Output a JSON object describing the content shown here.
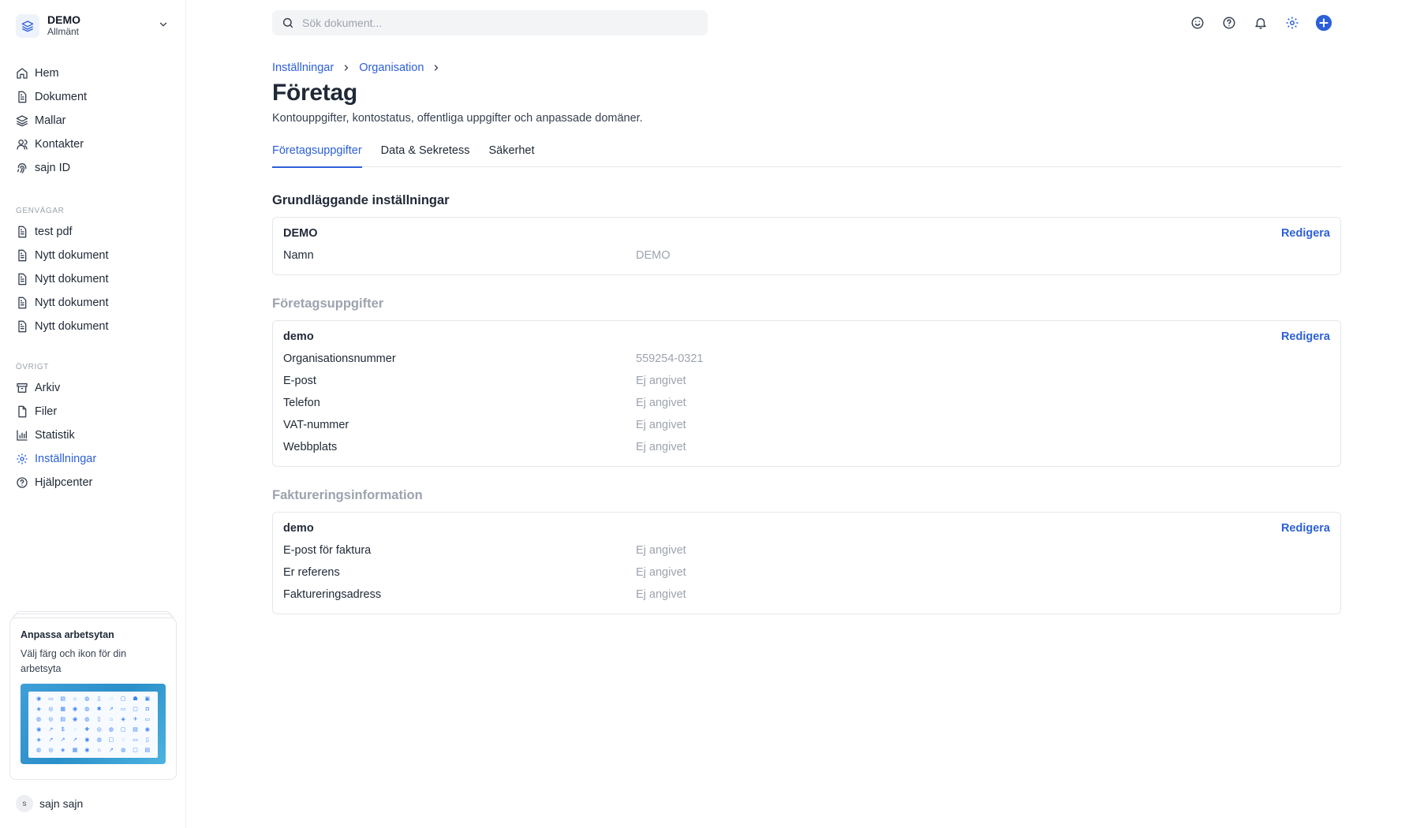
{
  "workspace": {
    "name": "DEMO",
    "subtitle": "Allmänt"
  },
  "nav": {
    "main": [
      {
        "label": "Hem",
        "icon": "home-icon"
      },
      {
        "label": "Dokument",
        "icon": "document-icon"
      },
      {
        "label": "Mallar",
        "icon": "layers-icon"
      },
      {
        "label": "Kontakter",
        "icon": "contacts-icon"
      },
      {
        "label": "sajn ID",
        "icon": "fingerprint-icon"
      }
    ],
    "shortcuts_title": "GENVÄGAR",
    "shortcuts": [
      {
        "label": "test pdf"
      },
      {
        "label": "Nytt dokument"
      },
      {
        "label": "Nytt dokument"
      },
      {
        "label": "Nytt dokument"
      },
      {
        "label": "Nytt dokument"
      }
    ],
    "other_title": "ÖVRIGT",
    "other": [
      {
        "label": "Arkiv",
        "icon": "archive-icon"
      },
      {
        "label": "Filer",
        "icon": "file-icon"
      },
      {
        "label": "Statistik",
        "icon": "chart-icon"
      },
      {
        "label": "Inställningar",
        "icon": "settings-icon",
        "active": true
      },
      {
        "label": "Hjälpcenter",
        "icon": "help-icon"
      }
    ]
  },
  "promo": {
    "title": "Anpassa arbetsytan",
    "text": "Välj färg och ikon för din arbetsyta"
  },
  "user": {
    "initial": "s",
    "name": "sajn sajn"
  },
  "search": {
    "placeholder": "Sök dokument..."
  },
  "breadcrumb": [
    "Inställningar",
    "Organisation"
  ],
  "page": {
    "title": "Företag",
    "description": "Kontouppgifter, kontostatus, offentliga uppgifter och anpassade domäner."
  },
  "tabs": [
    {
      "label": "Företagsuppgifter",
      "active": true
    },
    {
      "label": "Data & Sekretess"
    },
    {
      "label": "Säkerhet"
    }
  ],
  "sections": [
    {
      "title": "Grundläggande inställningar",
      "card_title": "DEMO",
      "edit_label": "Redigera",
      "rows": [
        {
          "label": "Namn",
          "value": "DEMO"
        }
      ]
    },
    {
      "title": "Företagsuppgifter",
      "card_title": "demo",
      "edit_label": "Redigera",
      "rows": [
        {
          "label": "Organisationsnummer",
          "value": "559254-0321"
        },
        {
          "label": "E-post",
          "value": "Ej angivet"
        },
        {
          "label": "Telefon",
          "value": "Ej angivet"
        },
        {
          "label": "VAT-nummer",
          "value": "Ej angivet"
        },
        {
          "label": "Webbplats",
          "value": "Ej angivet"
        }
      ]
    },
    {
      "title": "Faktureringsinformation",
      "card_title": "demo",
      "edit_label": "Redigera",
      "rows": [
        {
          "label": "E-post för faktura",
          "value": "Ej angivet"
        },
        {
          "label": "Er referens",
          "value": "Ej angivet"
        },
        {
          "label": "Faktureringsadress",
          "value": "Ej angivet"
        }
      ]
    }
  ],
  "colors": {
    "accent": "#2b5fd9",
    "muted": "#9ca3af",
    "border": "#e5e7eb"
  }
}
